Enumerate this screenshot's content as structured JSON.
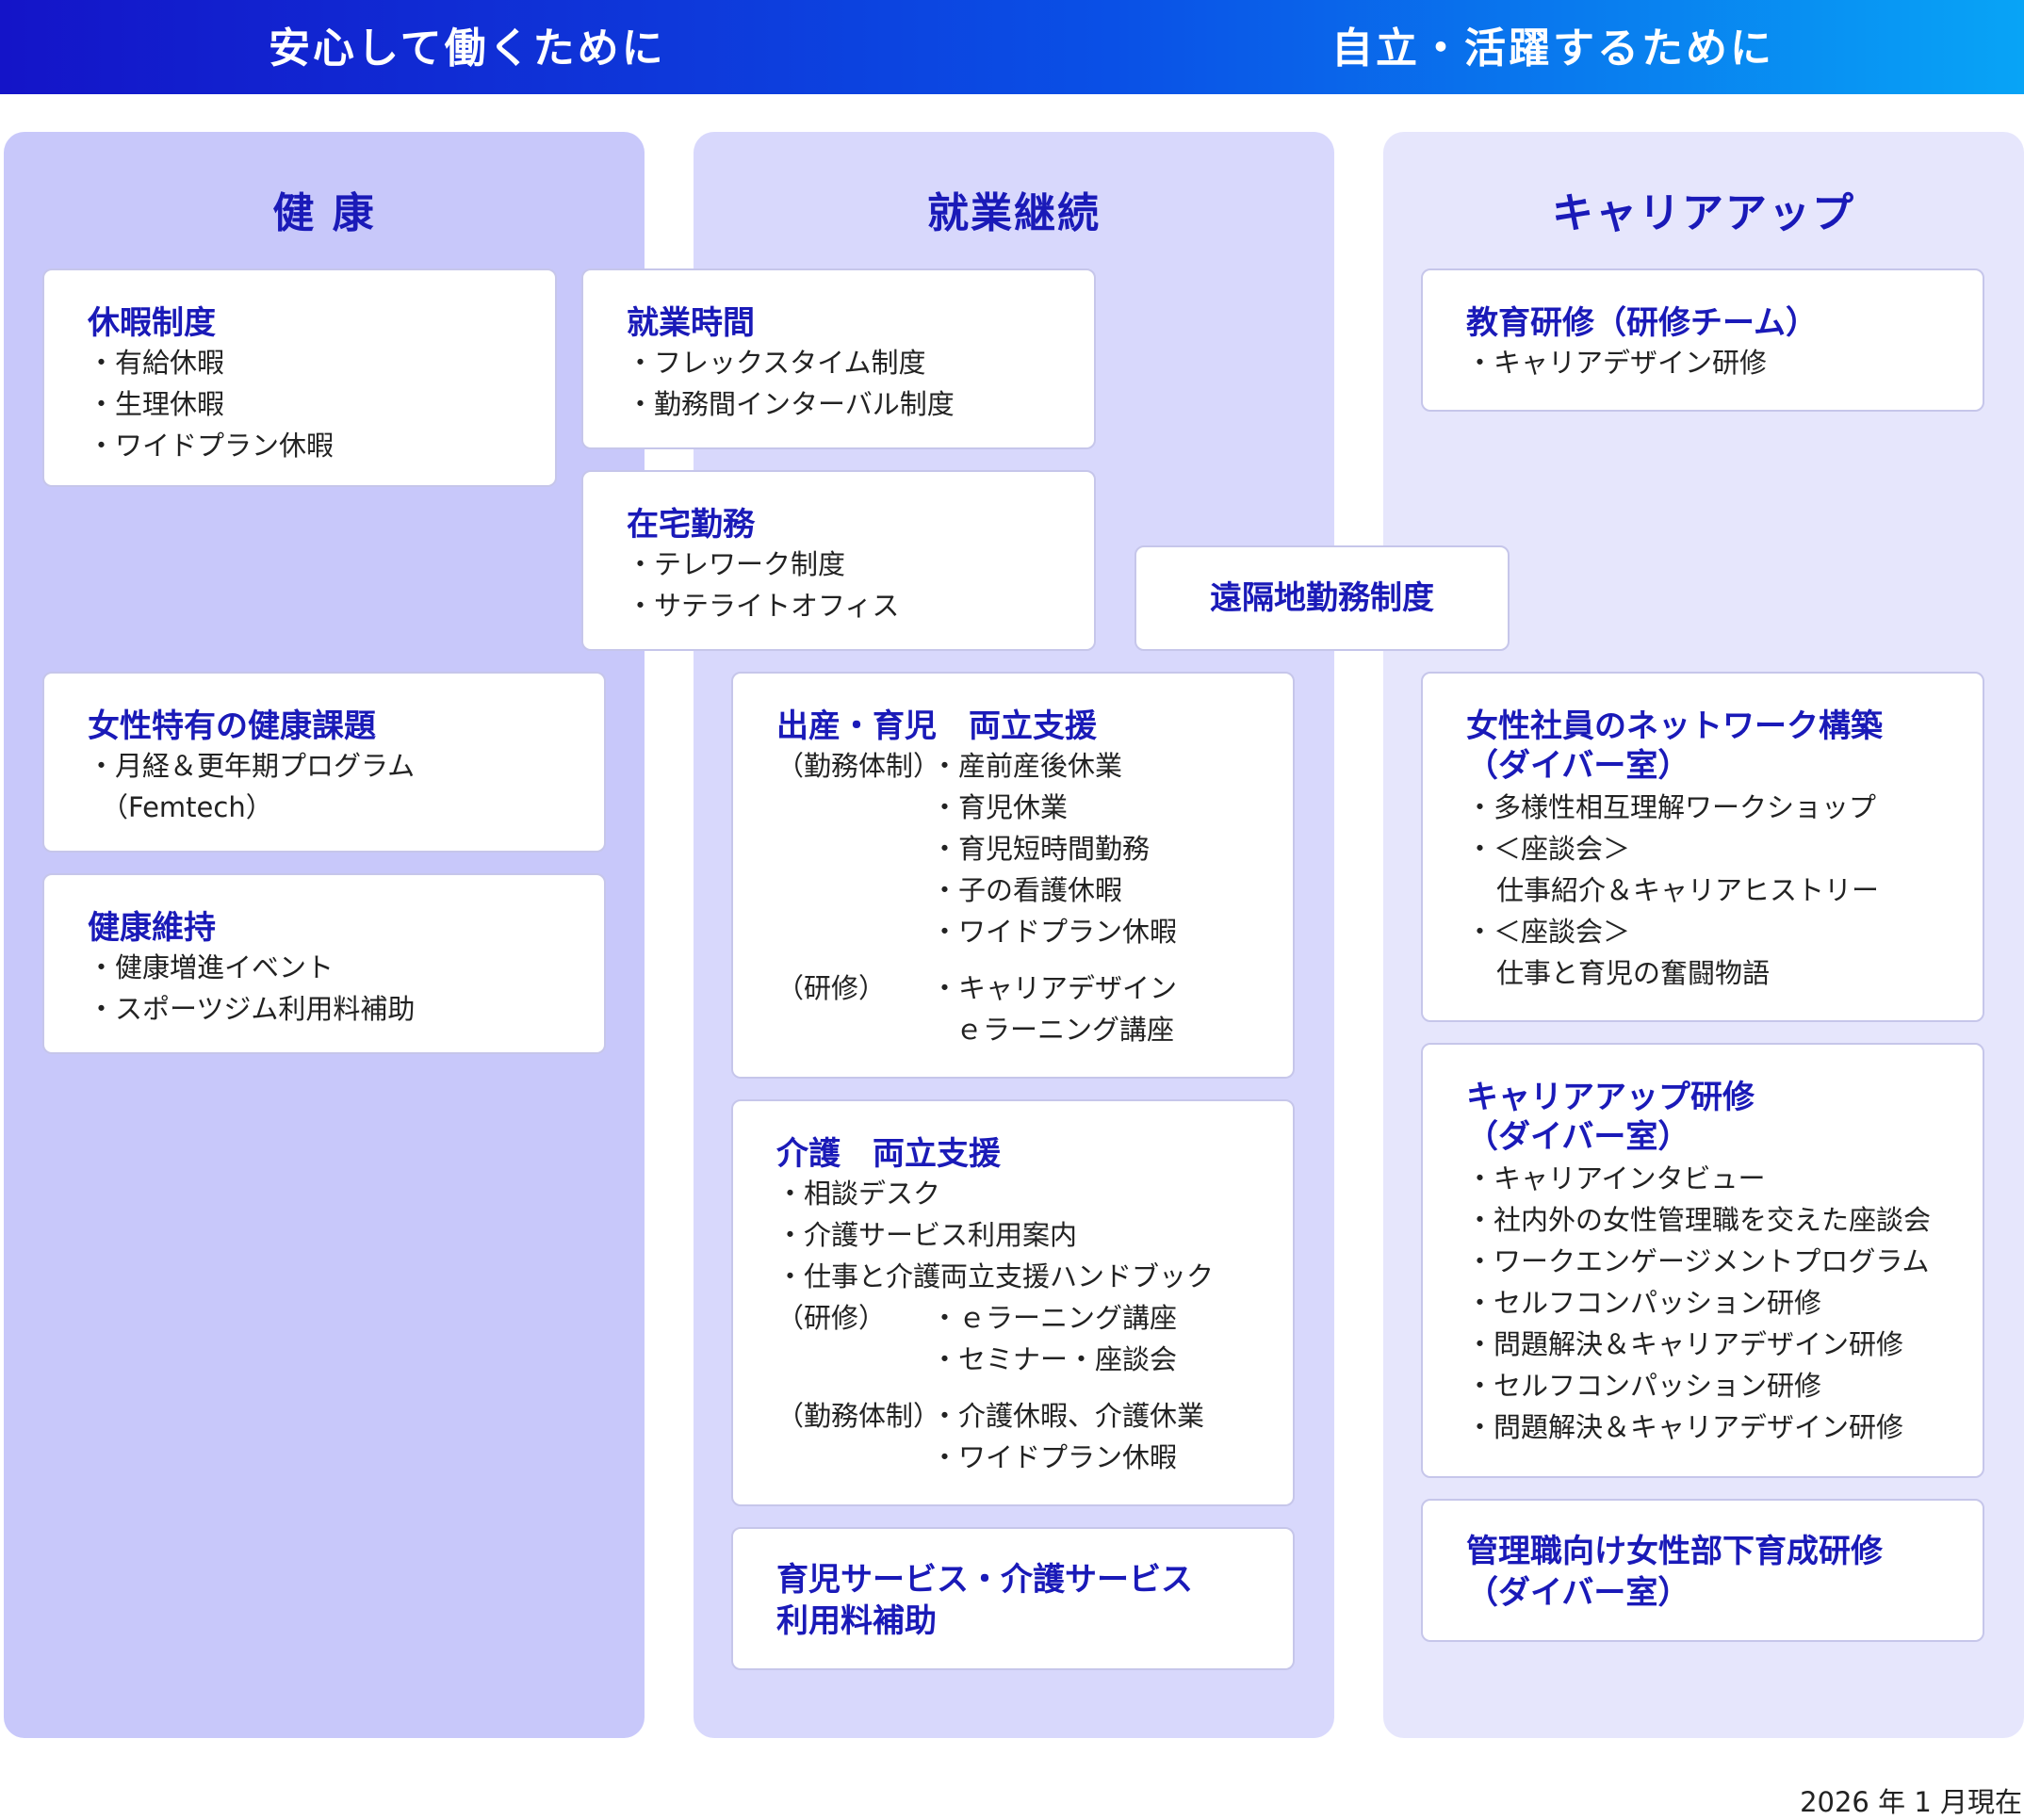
{
  "banner": {
    "left": "安心して働くために",
    "right": "自立・活躍するために"
  },
  "columns": {
    "health": "健 康",
    "employment": "就業継続",
    "career": "キャリアアップ"
  },
  "cards": {
    "leave": {
      "title": "休暇制度",
      "items": [
        "・有給休暇",
        "・生理休暇",
        "・ワイドプラン休暇"
      ]
    },
    "womens_health": {
      "title": "女性特有の健康課題",
      "items": [
        "・月経＆更年期プログラム",
        "（Femtech）"
      ]
    },
    "wellness": {
      "title": "健康維持",
      "items": [
        "・健康増進イベント",
        "・スポーツジム利用料補助"
      ]
    },
    "work_hours": {
      "title": "就業時間",
      "items": [
        "・フレックスタイム制度",
        "・勤務間インターバル制度"
      ]
    },
    "remote": {
      "title": "在宅勤務",
      "items": [
        "・テレワーク制度",
        "・サテライトオフィス"
      ]
    },
    "distant": {
      "title": "遠隔地勤務制度"
    },
    "childcare": {
      "title": "出産・育児　両立支援",
      "label_work": "（勤務体制）",
      "items_work": [
        "・産前産後休業",
        "・育児休業",
        "・育児短時間勤務",
        "・子の看護休暇",
        "・ワイドプラン休暇"
      ],
      "label_training": "（研修）",
      "items_training": [
        "・キャリアデザイン",
        "ｅラーニング講座"
      ]
    },
    "nursing": {
      "title": "介護　両立支援",
      "items": [
        "・相談デスク",
        "・介護サービス利用案内",
        "・仕事と介護両立支援ハンドブック"
      ],
      "label_training": "（研修）",
      "items_training": [
        "・ｅラーニング講座",
        "・セミナー・座談会"
      ],
      "label_work": "（勤務体制）",
      "items_work": [
        "・介護休暇、介護休業",
        "・ワイドプラン休暇"
      ]
    },
    "service_subsidy": {
      "title_lines": [
        "育児サービス・介護サービス",
        "利用料補助"
      ]
    },
    "education": {
      "title": "教育研修（研修チーム）",
      "items": [
        "・キャリアデザイン研修"
      ]
    },
    "network": {
      "title_lines": [
        "女性社員のネットワーク構築",
        "（ダイバー室）"
      ],
      "items": [
        "・多様性相互理解ワークショップ",
        "・＜座談会＞",
        "仕事紹介＆キャリアヒストリー",
        "・＜座談会＞",
        "仕事と育児の奮闘物語"
      ]
    },
    "career_training": {
      "title_lines": [
        "キャリアアップ研修",
        "（ダイバー室）"
      ],
      "items": [
        "・キャリアインタビュー",
        "・社内外の女性管理職を交えた座談会",
        "・ワークエンゲージメントプログラム",
        "・セルフコンパッション研修",
        "・問題解決＆キャリアデザイン研修",
        "・セルフコンパッション研修",
        "・問題解決＆キャリアデザイン研修"
      ]
    },
    "manager_training": {
      "title_lines": [
        "管理職向け女性部下育成研修",
        "（ダイバー室）"
      ]
    }
  },
  "footnote": "2026 年 1 月現在",
  "colors": {
    "banner_start": "#1414c8",
    "banner_end": "#08a4f6",
    "health_column": "#c8c8fa",
    "employment_column": "#d8d8fc",
    "career_column": "#e6e6fc",
    "heading_text": "#1a1ab8"
  }
}
